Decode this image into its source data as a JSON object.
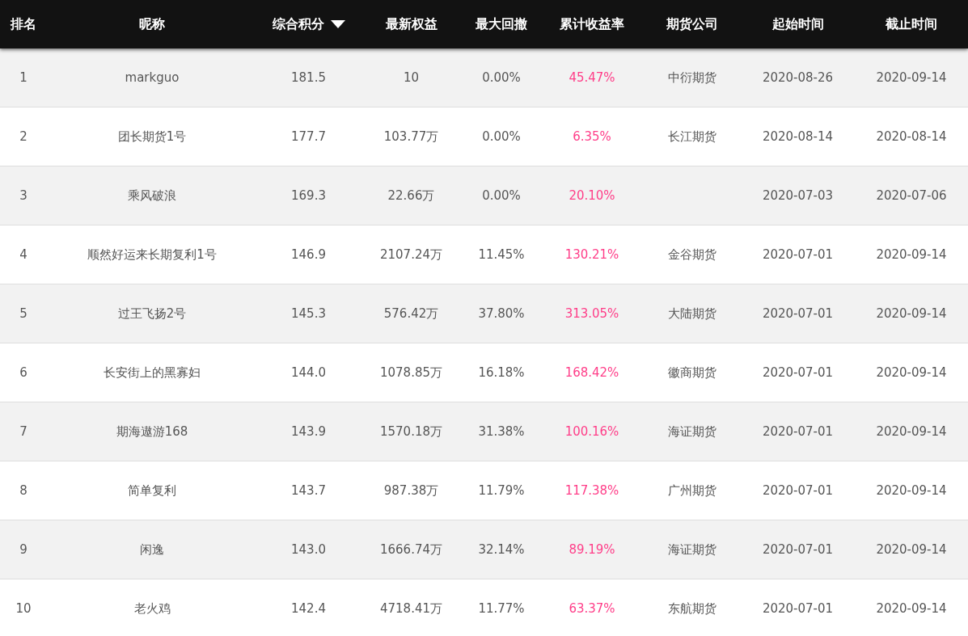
{
  "table": {
    "columns": [
      {
        "label": "排名",
        "sorted": false,
        "highlight": false
      },
      {
        "label": "昵称",
        "sorted": false,
        "highlight": false
      },
      {
        "label": "综合积分",
        "sorted": true,
        "highlight": false
      },
      {
        "label": "最新权益",
        "sorted": false,
        "highlight": false
      },
      {
        "label": "最大回撤",
        "sorted": false,
        "highlight": false
      },
      {
        "label": "累计收益率",
        "sorted": false,
        "highlight": true
      },
      {
        "label": "期货公司",
        "sorted": false,
        "highlight": false
      },
      {
        "label": "起始时间",
        "sorted": false,
        "highlight": false
      },
      {
        "label": "截止时间",
        "sorted": false,
        "highlight": false
      }
    ],
    "rows": [
      [
        "1",
        "markguo",
        "181.5",
        "10",
        "0.00%",
        "45.47%",
        "中衍期货",
        "2020-08-26",
        "2020-09-14"
      ],
      [
        "2",
        "团长期货1号",
        "177.7",
        "103.77万",
        "0.00%",
        "6.35%",
        "长江期货",
        "2020-08-14",
        "2020-08-14"
      ],
      [
        "3",
        "乘风破浪",
        "169.3",
        "22.66万",
        "0.00%",
        "20.10%",
        null,
        "2020-07-03",
        "2020-07-06"
      ],
      [
        "4",
        "顺然好运来长期复利1号",
        "146.9",
        "2107.24万",
        "11.45%",
        "130.21%",
        "金谷期货",
        "2020-07-01",
        "2020-09-14"
      ],
      [
        "5",
        "过王飞扬2号",
        "145.3",
        "576.42万",
        "37.80%",
        "313.05%",
        "大陆期货",
        "2020-07-01",
        "2020-09-14"
      ],
      [
        "6",
        "长安街上的黑寡妇",
        "144.0",
        "1078.85万",
        "16.18%",
        "168.42%",
        "徽商期货",
        "2020-07-01",
        "2020-09-14"
      ],
      [
        "7",
        "期海遨游168",
        "143.9",
        "1570.18万",
        "31.38%",
        "100.16%",
        "海证期货",
        "2020-07-01",
        "2020-09-14"
      ],
      [
        "8",
        "简单复利",
        "143.7",
        "987.38万",
        "11.79%",
        "117.38%",
        "广州期货",
        "2020-07-01",
        "2020-09-14"
      ],
      [
        "9",
        "闲逸",
        "143.0",
        "1666.74万",
        "32.14%",
        "89.19%",
        "海证期货",
        "2020-07-01",
        "2020-09-14"
      ],
      [
        "10",
        "老火鸡",
        "142.4",
        "4718.41万",
        "11.77%",
        "63.37%",
        "东航期货",
        "2020-07-01",
        "2020-09-14"
      ]
    ]
  }
}
